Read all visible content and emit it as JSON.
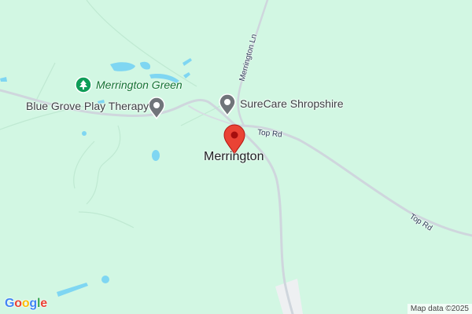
{
  "map": {
    "place_name": "Merrington",
    "pois": [
      {
        "name": "Merrington Green",
        "kind": "park",
        "icon": "tree-icon",
        "color": "#0f9d58"
      },
      {
        "name": "Blue Grove Play Therapy",
        "kind": "business",
        "icon": "pin-icon",
        "color": "#70757a"
      },
      {
        "name": "SureCare Shropshire",
        "kind": "business",
        "icon": "pin-icon",
        "color": "#70757a"
      }
    ],
    "roads": [
      {
        "name": "Merrington Ln"
      },
      {
        "name": "Top Rd"
      },
      {
        "name": "Top Rd"
      }
    ],
    "marker": {
      "icon": "red-location-pin-icon",
      "color": "#ea4335"
    },
    "attribution": "Map data ©2025",
    "logo": {
      "text": "Google",
      "letters": [
        "G",
        "o",
        "o",
        "g",
        "l",
        "e"
      ],
      "colors": [
        "#4285f4",
        "#ea4335",
        "#fbbc05",
        "#4285f4",
        "#34a853",
        "#ea4335"
      ]
    },
    "colors": {
      "land": "#d2f7e3",
      "road": "#cfd6dd",
      "water": "#7fd6f2",
      "built": "#eef0f2"
    }
  }
}
